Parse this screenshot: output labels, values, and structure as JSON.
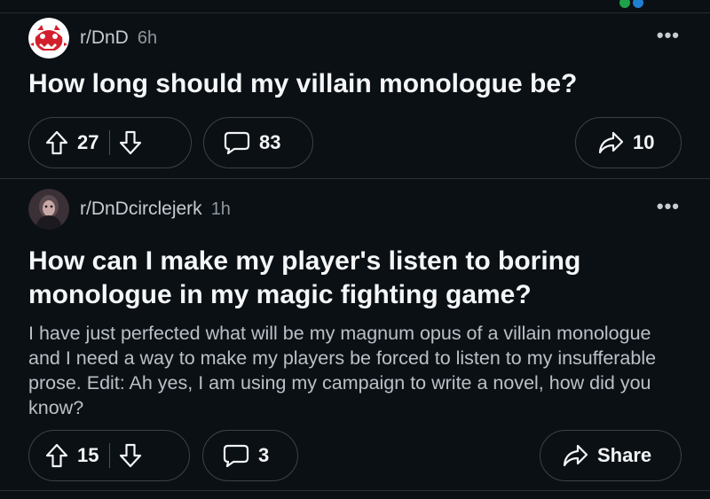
{
  "posts": [
    {
      "subreddit": "r/DnD",
      "age": "6h",
      "title": "How long should my villain monologue be?",
      "upvotes": "27",
      "comments": "83",
      "share": "10"
    },
    {
      "subreddit": "r/DnDcirclejerk",
      "age": "1h",
      "title": "How can I make my player's listen to boring monologue in my magic fighting game?",
      "body": "I have just perfected what will be my magnum opus of a villain monologue and I need a way to make my players be forced to listen to my insufferable prose. Edit: Ah yes, I am using my campaign to write a novel, how did you know?",
      "upvotes": "15",
      "comments": "3",
      "share": "Share"
    }
  ],
  "more_label": "•••",
  "colors": {
    "background": "#0b1015",
    "border": "#3a4249",
    "text": "#f2f4f5",
    "muted": "#b9c1c7",
    "dnd_red": "#d21f2b"
  },
  "icons": [
    "dnd-dragon-avatar-icon",
    "circlejerk-avatar-icon",
    "more-options-icon",
    "upvote-arrow-icon",
    "downvote-arrow-icon",
    "comment-bubble-icon",
    "share-arrow-icon"
  ]
}
